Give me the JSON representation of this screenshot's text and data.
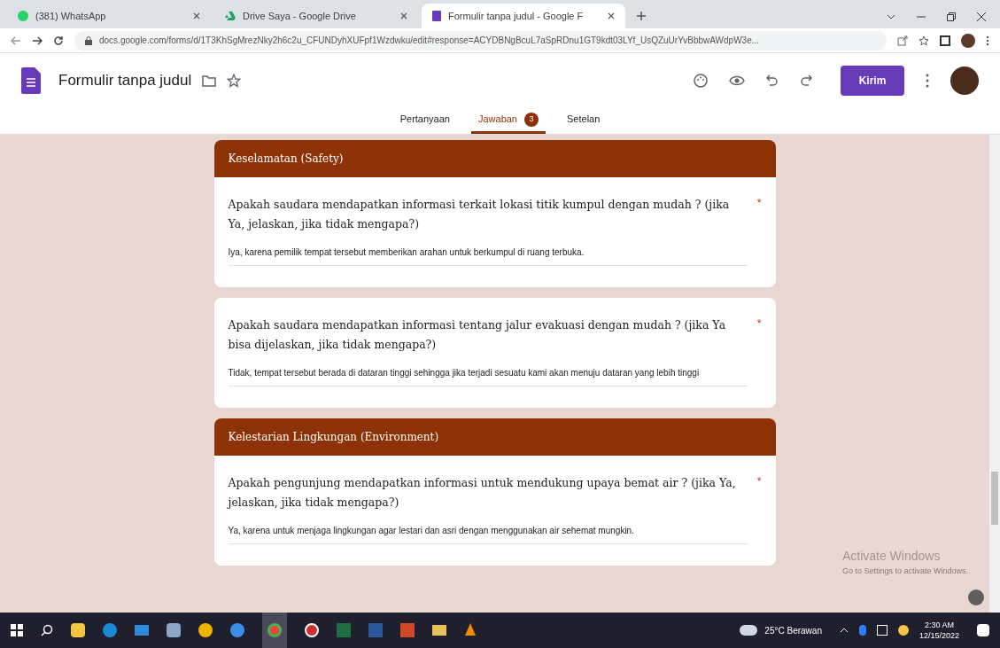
{
  "browser": {
    "tabs": [
      {
        "title": "(381) WhatsApp",
        "selected": false,
        "kind": "chat"
      },
      {
        "title": "Drive Saya - Google Drive",
        "selected": false,
        "kind": "drive"
      },
      {
        "title": "Formulir tanpa judul - Google F",
        "selected": true,
        "kind": "form"
      }
    ],
    "address": "docs.google.com/forms/d/1T3KhSgMrezNky2h6c2u_CFUNDyhXUFpf1Wzdwku/edit#response=ACYDBNgBcuL7aSpRDnu1GT9kdt03LYf_UsQZuUrYvBbbwAWdpW3e..."
  },
  "form": {
    "title": "Formulir tanpa judul",
    "send": "Kirim",
    "tabs": [
      {
        "label": "Pertanyaan",
        "selected": false
      },
      {
        "label": "Jawaban",
        "selected": true,
        "badge": "3"
      },
      {
        "label": "Setelan",
        "selected": false
      }
    ]
  },
  "items": [
    {
      "kind": "section",
      "title": "Keselamatan (Safety)"
    },
    {
      "kind": "question",
      "question": "Apakah saudara mendapatkan informasi terkait lokasi titik kumpul dengan mudah ?  (jika Ya, jelaskan, jika tidak mengapa?)",
      "required_mark": "*",
      "answer": "Iya, karena pemilik tempat tersebut memberikan arahan untuk berkumpul di ruang terbuka."
    },
    {
      "kind": "question",
      "question": "Apakah saudara mendapatkan informasi tentang jalur evakuasi dengan mudah ?  (jika Ya bisa dijelaskan, jika tidak mengapa?)",
      "required_mark": "*",
      "answer": "Tidak, tempat tersebut berada di dataran tinggi sehingga jika terjadi sesuatu kami akan menuju dataran yang lebih tinggi"
    },
    {
      "kind": "section",
      "title": "Kelestarian Lingkungan (Environment)"
    },
    {
      "kind": "question",
      "question": "Apakah pengunjung mendapatkan informasi untuk mendukung upaya bemat air ?  (jika Ya, jelaskan, jika tidak mengapa?)",
      "required_mark": "*",
      "answer": "Ya, karena untuk menjaga lingkungan agar lestari dan asri dengan menggunakan air sehemat mungkin."
    }
  ],
  "watermark": {
    "title": "Activate Windows",
    "subtitle": "Go to Settings to activate Windows."
  },
  "taskbar": {
    "weather": "25°C Berawan",
    "time": "2:30 AM",
    "date": "12/15/2022"
  }
}
